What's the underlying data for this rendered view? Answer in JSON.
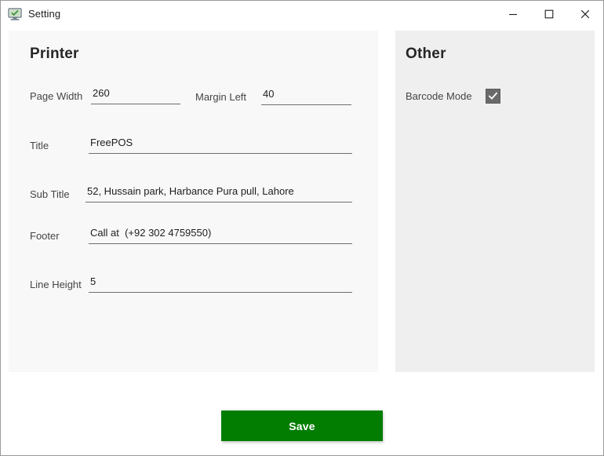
{
  "window": {
    "title": "Setting",
    "icon": "monitor-check-icon",
    "controls": {
      "minimize": "minimize-icon",
      "maximize": "maximize-icon",
      "close": "close-icon"
    }
  },
  "printer_panel": {
    "heading": "Printer",
    "fields": {
      "page_width": {
        "label": "Page Width",
        "value": "260"
      },
      "margin_left": {
        "label": "Margin Left",
        "value": "40"
      },
      "title": {
        "label": "Title",
        "value": "FreePOS"
      },
      "sub_title": {
        "label": "Sub Title",
        "value": "52, Hussain park, Harbance Pura pull, Lahore"
      },
      "footer": {
        "label": "Footer",
        "value": "Call at  (+92 302 4759550)"
      },
      "line_height": {
        "label": "Line Height",
        "value": "5"
      }
    }
  },
  "other_panel": {
    "heading": "Other",
    "barcode_mode": {
      "label": "Barcode Mode",
      "checked": "checked",
      "icon": "checkmark-icon"
    }
  },
  "footer_bar": {
    "save_label": "Save"
  },
  "colors": {
    "save_green": "#027d02",
    "panel_left_bg": "#f8f8f8",
    "panel_right_bg": "#efefef",
    "checkbox_fill": "#6a6a6a",
    "underline": "#6e6e6e"
  }
}
